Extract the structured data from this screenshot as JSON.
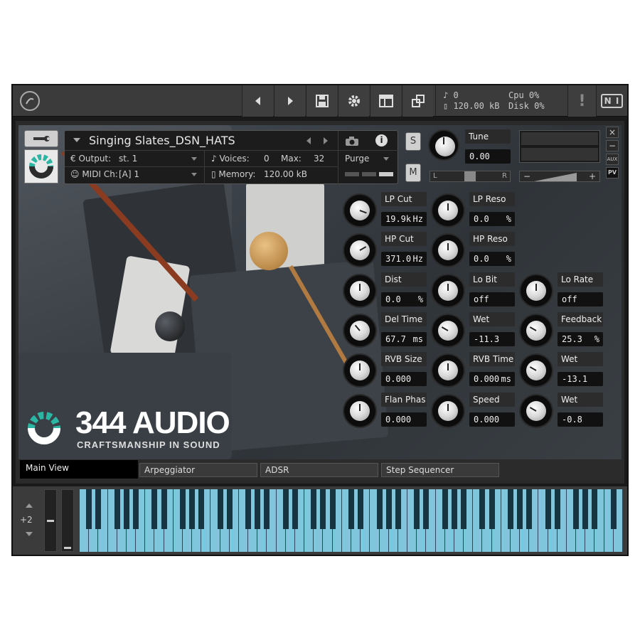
{
  "toolbar": {
    "logo_icon": "kontakt-logo-icon",
    "buttons": [
      "prev-icon",
      "next-icon",
      "save-icon",
      "gear-icon",
      "layout-icon",
      "resize-icon"
    ],
    "midi_count": "0",
    "memory": "120.00 kB",
    "cpu_label": "Cpu",
    "cpu_value": "0%",
    "disk_label": "Disk",
    "disk_value": "0%",
    "warning": "!",
    "ni_logo": "N I"
  },
  "instrument": {
    "name": "Singing Slates_DSN_HATS",
    "output_label": "Output:",
    "output_value": "st. 1",
    "voices_label": "Voices:",
    "voices_value": "0",
    "max_label": "Max:",
    "max_value": "32",
    "purge_label": "Purge",
    "midi_label": "MIDI Ch:",
    "midi_value": "[A]  1",
    "memory_label": "Memory:",
    "memory_value": "120.00 kB",
    "solo": "S",
    "mute": "M",
    "tune_label": "Tune",
    "tune_value": "0.00",
    "pan_left": "L",
    "pan_right": "R",
    "vol_minus": "−",
    "vol_plus": "+",
    "close": "×",
    "minimize": "−",
    "aux": "AUX",
    "pv": "PV"
  },
  "params": [
    {
      "label": "LP Cut",
      "value": "19.9k",
      "unit": "Hz"
    },
    {
      "label": "LP Reso",
      "value": "0.0",
      "unit": "%"
    },
    {
      "label": "HP Cut",
      "value": "371.0",
      "unit": "Hz"
    },
    {
      "label": "HP Reso",
      "value": "0.0",
      "unit": "%"
    },
    {
      "label": "Dist",
      "value": "0.0",
      "unit": "%"
    },
    {
      "label": "Lo Bit",
      "value": "off",
      "unit": ""
    },
    {
      "label": "Lo Rate",
      "value": "off",
      "unit": ""
    },
    {
      "label": "Del Time",
      "value": "67.7",
      "unit": "ms"
    },
    {
      "label": "Wet",
      "value": "-11.3",
      "unit": ""
    },
    {
      "label": "Feedback",
      "value": "25.3",
      "unit": "%"
    },
    {
      "label": "RVB Size",
      "value": "0.000",
      "unit": ""
    },
    {
      "label": "RVB Time",
      "value": "0.000",
      "unit": "ms"
    },
    {
      "label": "Wet",
      "value": "-13.1",
      "unit": ""
    },
    {
      "label": "Flan Phas",
      "value": "0.000",
      "unit": ""
    },
    {
      "label": "Speed",
      "value": "0.000",
      "unit": ""
    },
    {
      "label": "Wet",
      "value": "-0.8",
      "unit": ""
    }
  ],
  "brand": {
    "name": "344 AUDIO",
    "tagline": "CRAFTSMANSHIP IN SOUND"
  },
  "tabs": [
    "Main View",
    "Arpeggiator",
    "ADSR",
    "Step Sequencer"
  ],
  "active_tab": "Main View",
  "keyboard": {
    "octave": "+2"
  }
}
